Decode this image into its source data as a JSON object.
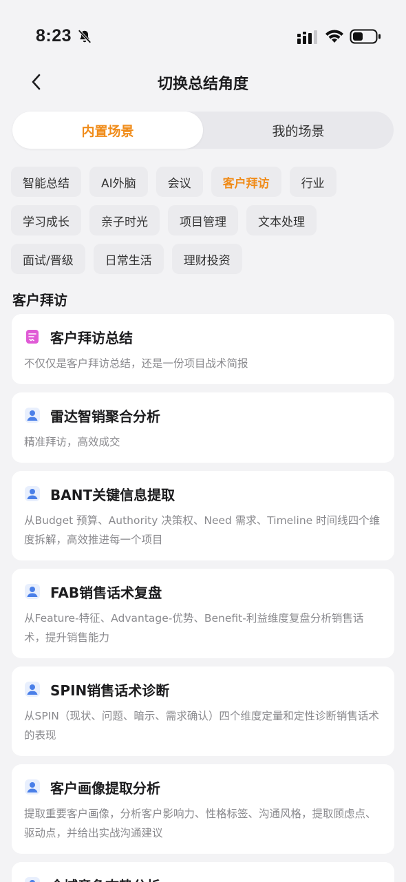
{
  "status_bar": {
    "time": "8:23"
  },
  "header": {
    "title": "切换总结角度"
  },
  "segment": {
    "tabs": [
      "内置场景",
      "我的场景"
    ],
    "active_index": 0
  },
  "categories": {
    "items": [
      "智能总结",
      "AI外脑",
      "会议",
      "客户拜访",
      "行业",
      "学习成长",
      "亲子时光",
      "项目管理",
      "文本处理",
      "面试/晋级",
      "日常生活",
      "理财投资"
    ],
    "active_index": 3
  },
  "section": {
    "title": "客户拜访"
  },
  "cards": [
    {
      "icon": "document-icon",
      "title": "客户拜访总结",
      "desc": "不仅仅是客户拜访总结，还是一份项目战术简报"
    },
    {
      "icon": "person-icon",
      "title": "雷达智销聚合分析",
      "desc": "精准拜访，高效成交"
    },
    {
      "icon": "person-icon",
      "title": "BANT关键信息提取",
      "desc": "从Budget 预算、Authority 决策权、Need 需求、Timeline 时间线四个维度拆解，高效推进每一个项目"
    },
    {
      "icon": "person-icon",
      "title": "FAB销售话术复盘",
      "desc": "从Feature-特征、Advantage-优势、Benefit-利益维度复盘分析销售话术，提升销售能力"
    },
    {
      "icon": "person-icon",
      "title": "SPIN销售话术诊断",
      "desc": "从SPIN（现状、问题、暗示、需求确认）四个维度定量和定性诊断销售话术的表现"
    },
    {
      "icon": "person-icon",
      "title": "客户画像提取分析",
      "desc": "提取重要客户画像，分析客户影响力、性格标签、沟通风格，提取顾虑点、驱动点，并给出实战沟通建议"
    },
    {
      "icon": "person-icon",
      "title": "全域竞争态势分析",
      "desc": ""
    }
  ],
  "colors": {
    "accent": "#f08c1a",
    "person_icon": "#4a7fe8",
    "document_icon": "#e05bd6"
  }
}
